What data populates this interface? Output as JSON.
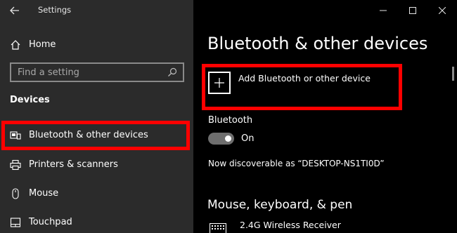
{
  "window": {
    "title": "Settings"
  },
  "sidebar": {
    "home_label": "Home",
    "search_placeholder": "Find a setting",
    "section_header": "Devices",
    "items": [
      {
        "label": "Bluetooth & other devices",
        "icon": "bluetooth-devices-icon"
      },
      {
        "label": "Printers & scanners",
        "icon": "printer-icon"
      },
      {
        "label": "Mouse",
        "icon": "mouse-icon"
      },
      {
        "label": "Touchpad",
        "icon": "touchpad-icon"
      }
    ]
  },
  "main": {
    "title": "Bluetooth & other devices",
    "add_device_label": "Add Bluetooth or other device",
    "bluetooth_heading": "Bluetooth",
    "bluetooth_state": "On",
    "bluetooth_on": true,
    "discoverable_text": "Now discoverable as “DESKTOP-NS1TI0D”",
    "mouse_section_heading": "Mouse, keyboard, & pen",
    "devices": [
      {
        "label": "2.4G Wireless Receiver",
        "icon": "keyboard-icon"
      }
    ]
  },
  "colors": {
    "sidebar_bg": "#2b2b2b",
    "main_bg": "#000000",
    "highlight": "#ff0000",
    "toggle_track": "#6e6e6e"
  }
}
